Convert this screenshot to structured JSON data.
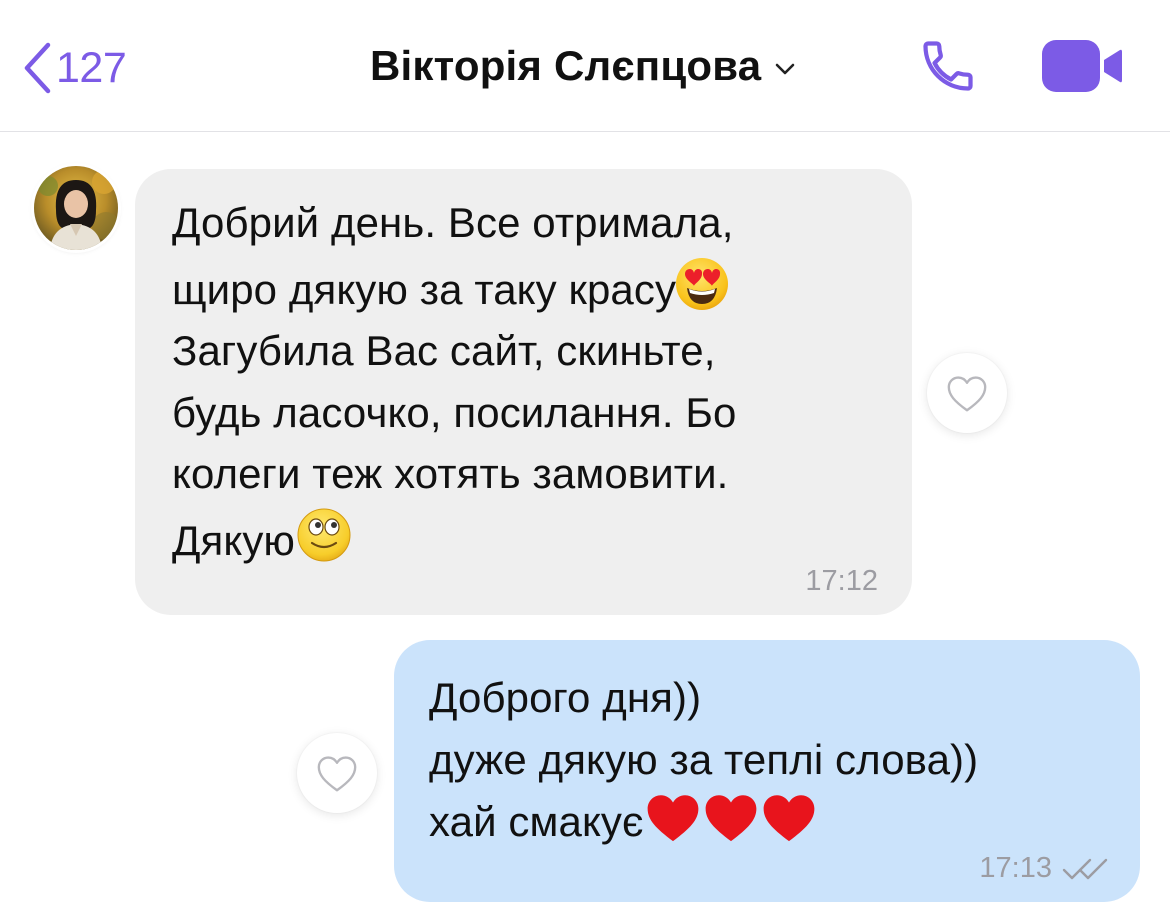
{
  "header": {
    "back_count": "127",
    "contact_name": "Вікторія Слєпцова",
    "back_icon": "chevron-left-icon",
    "call_icon": "phone-icon",
    "video_icon": "video-camera-icon",
    "dropdown_icon": "chevron-down-icon"
  },
  "messages": [
    {
      "direction": "incoming",
      "lines": [
        "Добрий день. Все отримала,",
        "щиро дякую за таку красу",
        "Загубила Вас сайт, скиньте,",
        "будь ласочко, посилання. Бо",
        "колеги теж хотять замовити.",
        "Дякую"
      ],
      "emojis": [
        "heart-eyes-emoji",
        "rolling-eyes-smile-emoji"
      ],
      "time": "17:12"
    },
    {
      "direction": "outgoing",
      "lines": [
        "Доброго дня))",
        "дуже дякую за теплі слова))",
        "хай смакує"
      ],
      "emojis": [
        "red-heart-emoji",
        "red-heart-emoji",
        "red-heart-emoji"
      ],
      "time": "17:13",
      "status_icon": "double-check-icon"
    }
  ],
  "colors": {
    "accent": "#7c5be6",
    "incoming_bubble": "#efefef",
    "outgoing_bubble": "#cbe3fb",
    "timestamp": "#9c9ca2",
    "heart": "#e8141c"
  }
}
